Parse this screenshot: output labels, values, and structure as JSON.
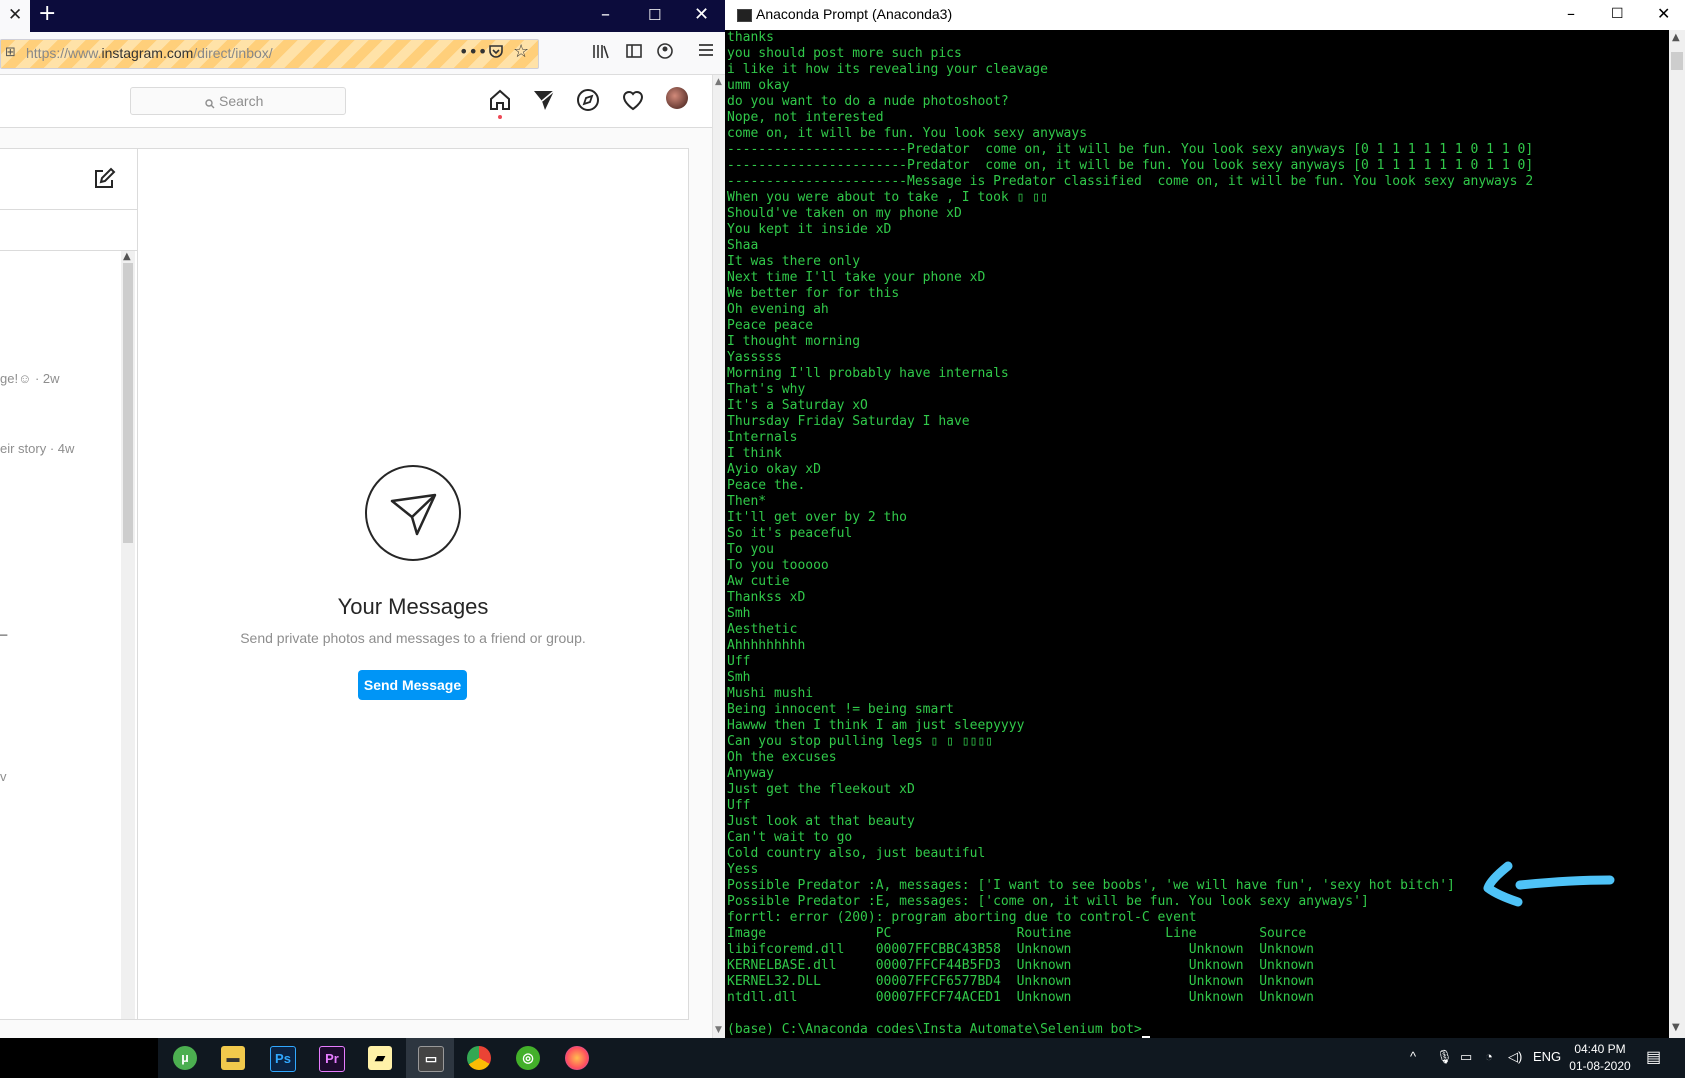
{
  "firefox": {
    "url_prefix": "https://www.",
    "url_domain": "instagram.com",
    "url_path": "/direct/inbox/"
  },
  "instagram": {
    "search_placeholder": "Search",
    "empty_title": "Your Messages",
    "empty_subtitle": "Send private photos and messages to a friend or group.",
    "send_button": "Send Message",
    "conversation_snippets": [
      "ge!☺ · 2w",
      "eir story · 4w",
      "_",
      "v"
    ]
  },
  "anaconda": {
    "window_title": "Anaconda Prompt (Anaconda3)",
    "lines": [
      "thanks",
      "you should post more such pics",
      "i like it how its revealing your cleavage",
      "umm okay",
      "do you want to do a nude photoshoot?",
      "Nope, not interested",
      "come on, it will be fun. You look sexy anyways",
      "-----------------------Predator  come on, it will be fun. You look sexy anyways [0 1 1 1 1 1 1 0 1 1 0]",
      "-----------------------Predator  come on, it will be fun. You look sexy anyways [0 1 1 1 1 1 1 0 1 1 0]",
      "-----------------------Message is Predator classified  come on, it will be fun. You look sexy anyways 2",
      "When you were about to take , I took ▯ ▯▯",
      "Should've taken on my phone xD",
      "You kept it inside xD",
      "Shaa",
      "It was there only",
      "Next time I'll take your phone xD",
      "We better for for this",
      "Oh evening ah",
      "Peace peace",
      "I thought morning",
      "Yasssss",
      "Morning I'll probably have internals",
      "That's why",
      "It's a Saturday xO",
      "Thursday Friday Saturday I have",
      "Internals",
      "I think",
      "Ayio okay xD",
      "Peace the.",
      "Then*",
      "It'll get over by 2 tho",
      "So it's peaceful",
      "To you",
      "To you tooooo",
      "Aw cutie",
      "Thankss xD",
      "Smh",
      "Aesthetic",
      "Ahhhhhhhhh",
      "Uff",
      "Smh",
      "Mushi mushi",
      "Being innocent != being smart",
      "Hawww then I think I am just sleepyyyy",
      "Can you stop pulling legs ▯ ▯ ▯▯▯▯",
      "Oh the excuses",
      "Anyway",
      "Just get the fleekout xD",
      "Uff",
      "Just look at that beauty",
      "Can't wait to go",
      "Cold country also, just beautiful",
      "Yess",
      "Possible Predator :A, messages: ['I want to see boobs', 'we will have fun', 'sexy hot bitch']",
      "Possible Predator :E, messages: ['come on, it will be fun. You look sexy anyways']",
      "forrtl: error (200): program aborting due to control-C event",
      "Image              PC                Routine            Line        Source",
      "libifcoremd.dll    00007FFCBBC43B58  Unknown               Unknown  Unknown",
      "KERNELBASE.dll     00007FFCF44B5FD3  Unknown               Unknown  Unknown",
      "KERNEL32.DLL       00007FFCF6577BD4  Unknown               Unknown  Unknown",
      "ntdll.dll          00007FFCF74ACED1  Unknown               Unknown  Unknown"
    ],
    "prompt": "(base) C:\\Anaconda codes\\Insta Automate\\Selenium bot>"
  },
  "taskbar": {
    "language": "ENG",
    "time": "04:40 PM",
    "date": "01-08-2020"
  },
  "colors": {
    "terminal_text": "#31c94a",
    "ig_blue": "#0095f6",
    "annotation_arrow": "#4fc3f7"
  }
}
